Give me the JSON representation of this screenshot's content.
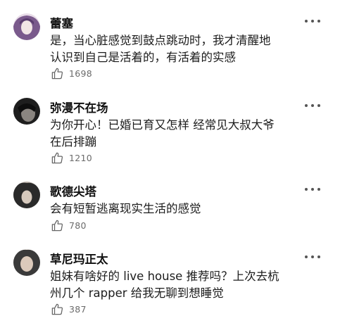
{
  "comments": [
    {
      "username": "蕾塞",
      "text_lines": [
        "是，当心脏感觉到鼓点跳动时，我才清醒地",
        "认识到自己是活着的，有活着的实感"
      ],
      "likes": "1698",
      "avatar_colors": [
        "#7a5a8c",
        "#d8c8d8"
      ]
    },
    {
      "username": "弥漫不在场",
      "text_lines": [
        "为你开心！已婚已育又怎样 经常见大叔大爷",
        "在后排蹦"
      ],
      "likes": "1210",
      "avatar_colors": [
        "#1e1e1e",
        "#8a8580"
      ]
    },
    {
      "username": "歌德尖塔",
      "text_lines": [
        "会有短暂逃离现实生活的感觉"
      ],
      "likes": "780",
      "avatar_colors": [
        "#2a2a2a",
        "#b8b0a8"
      ]
    },
    {
      "username": "草尼玛正太",
      "text_lines": [
        "姐妹有啥好的 live house 推荐吗？上次去杭",
        "州几个 rapper 给我无聊到想睡觉"
      ],
      "likes": "387",
      "avatar_colors": [
        "#3a3a3a",
        "#c9b8a8"
      ]
    }
  ],
  "icons": {
    "like": "thumbs-up-icon",
    "more": "more-dots-icon"
  }
}
